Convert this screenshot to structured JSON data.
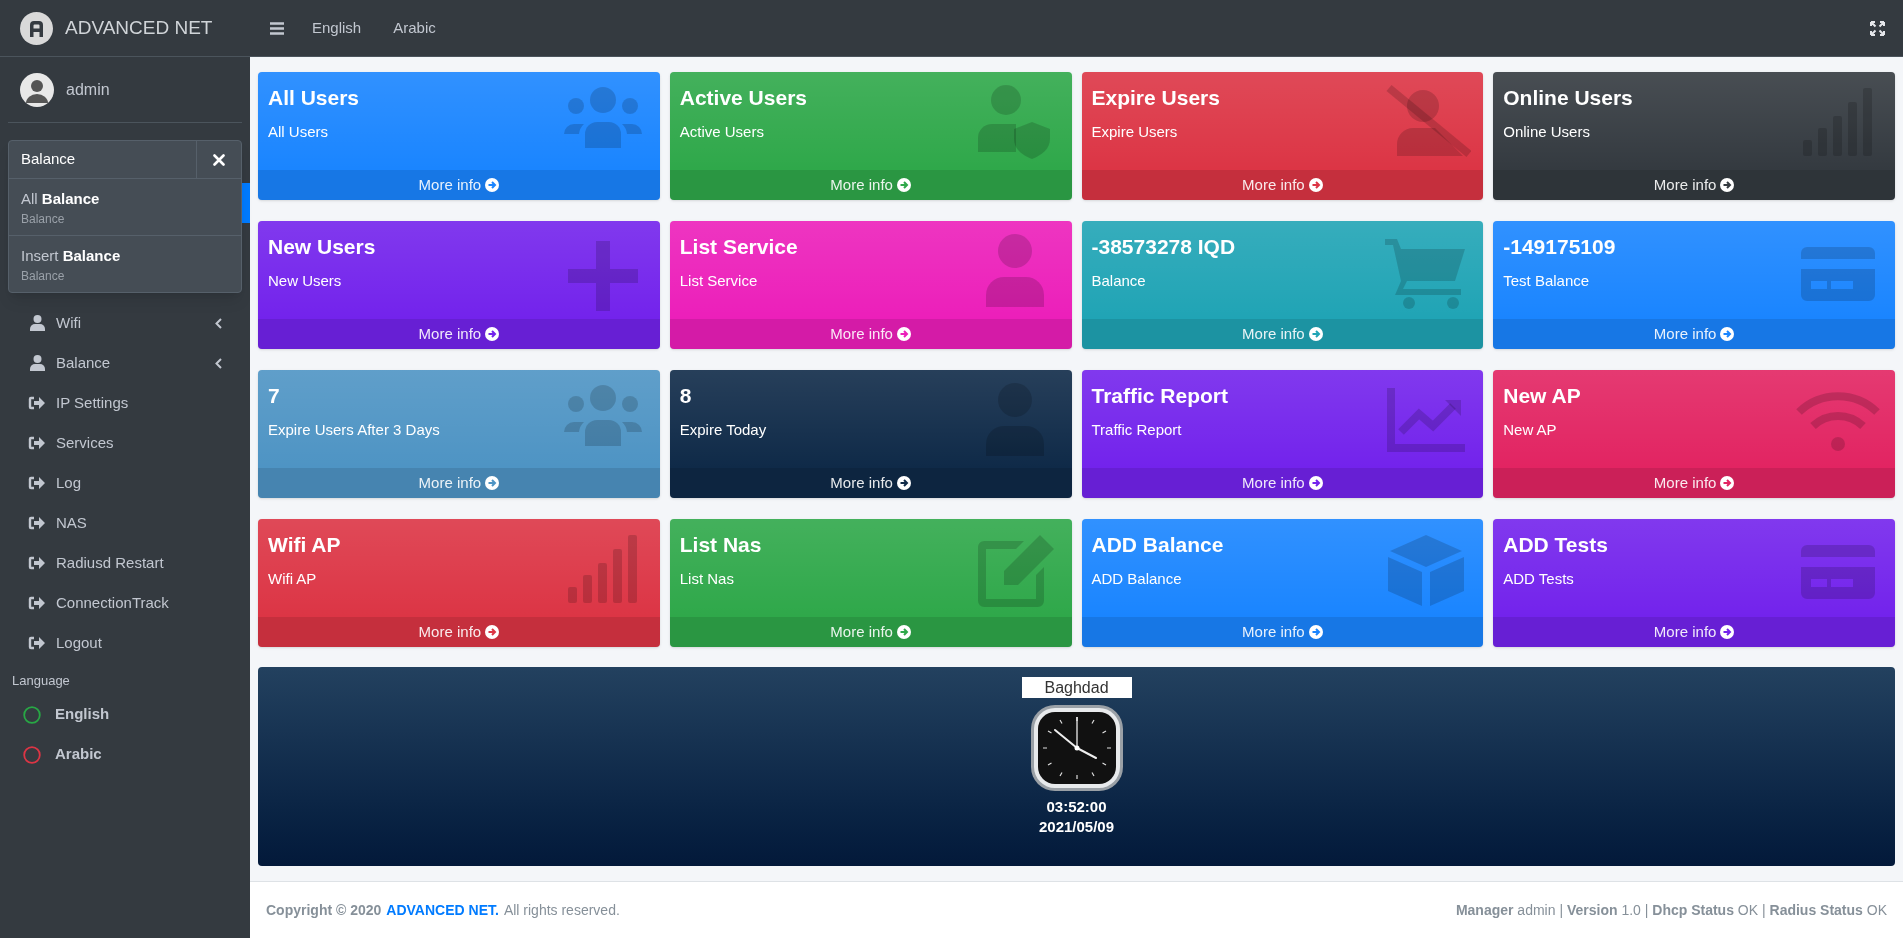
{
  "brand": {
    "title": "ADVANCED NET"
  },
  "user": {
    "name": "admin"
  },
  "search": {
    "value": "Balance",
    "results": [
      {
        "title": "All **Balance**",
        "subtitle": "Balance"
      },
      {
        "title": "Insert **Balance**",
        "subtitle": "Balance"
      }
    ]
  },
  "sidebar": {
    "items": [
      {
        "label": "Wifi",
        "kind": "group"
      },
      {
        "label": "Balance",
        "kind": "group"
      },
      {
        "label": "IP Settings",
        "kind": "link"
      },
      {
        "label": "Services",
        "kind": "link"
      },
      {
        "label": "Log",
        "kind": "link"
      },
      {
        "label": "NAS",
        "kind": "link"
      },
      {
        "label": "Radiusd Restart",
        "kind": "link"
      },
      {
        "label": "ConnectionTrack",
        "kind": "link"
      },
      {
        "label": "Logout",
        "kind": "link"
      }
    ],
    "language_header": "Language",
    "languages": [
      {
        "label": "English",
        "color": "#28a745"
      },
      {
        "label": "Arabic",
        "color": "#dc3545"
      }
    ]
  },
  "topbar": {
    "links": [
      "English",
      "Arabic"
    ]
  },
  "cards": [
    {
      "title": "All Users",
      "subtitle": "All Users",
      "link": "More info",
      "color": "#1a85ff",
      "kind": "users"
    },
    {
      "title": "Active Users",
      "subtitle": "Active Users",
      "link": "More info",
      "color": "#2fa84a",
      "kind": "user-shield"
    },
    {
      "title": "Expire Users",
      "subtitle": "Expire Users",
      "link": "More info",
      "color": "#dc3545",
      "kind": "user-slash"
    },
    {
      "title": "Online Users",
      "subtitle": "Online Users",
      "link": "More info",
      "color": "#343a40",
      "kind": "signal"
    },
    {
      "title": "New Users",
      "subtitle": "New Users",
      "link": "More info",
      "color": "#7323ec",
      "kind": "plus"
    },
    {
      "title": "List Service",
      "subtitle": "List Service",
      "link": "More info",
      "color": "#ec1fba",
      "kind": "user"
    },
    {
      "title": "-38573278 IQD",
      "subtitle": "Balance",
      "link": "More info",
      "color": "#20a4b5",
      "kind": "cart"
    },
    {
      "title": "-149175109",
      "subtitle": "Test Balance",
      "link": "More info",
      "color": "#1a85ff",
      "kind": "card"
    },
    {
      "title": "7",
      "subtitle": "Expire Users After 3 Days",
      "link": "More info",
      "color": "#4e94c4",
      "kind": "users"
    },
    {
      "title": "8",
      "subtitle": "Expire Today",
      "link": "More info",
      "color": "#0f2a48",
      "kind": "user"
    },
    {
      "title": "Traffic Report",
      "subtitle": "Traffic Report",
      "link": "More info",
      "color": "#7323ec",
      "kind": "chart"
    },
    {
      "title": "New AP",
      "subtitle": "New AP",
      "link": "More info",
      "color": "#e22462",
      "kind": "wifi"
    },
    {
      "title": "Wifi AP",
      "subtitle": "Wifi AP",
      "link": "More info",
      "color": "#dc3545",
      "kind": "signal"
    },
    {
      "title": "List Nas",
      "subtitle": "List Nas",
      "link": "More info",
      "color": "#2fa84a",
      "kind": "edit"
    },
    {
      "title": "ADD Balance",
      "subtitle": "ADD Balance",
      "link": "More info",
      "color": "#1a85ff",
      "kind": "box"
    },
    {
      "title": "ADD Tests",
      "subtitle": "ADD Tests",
      "link": "More info",
      "color": "#7323ec",
      "kind": "card"
    }
  ],
  "clock": {
    "city": "Baghdad",
    "time": "03:52:00",
    "date": "2021/05/09"
  },
  "footer": {
    "copyright": "**Copyright © 2020**",
    "brand_link": "ADVANCED NET.",
    "rights": "All rights reserved.",
    "status": "**Manager** admin | **Version** 1.0 | **Dhcp Status** OK | **Radius Status** OK"
  }
}
